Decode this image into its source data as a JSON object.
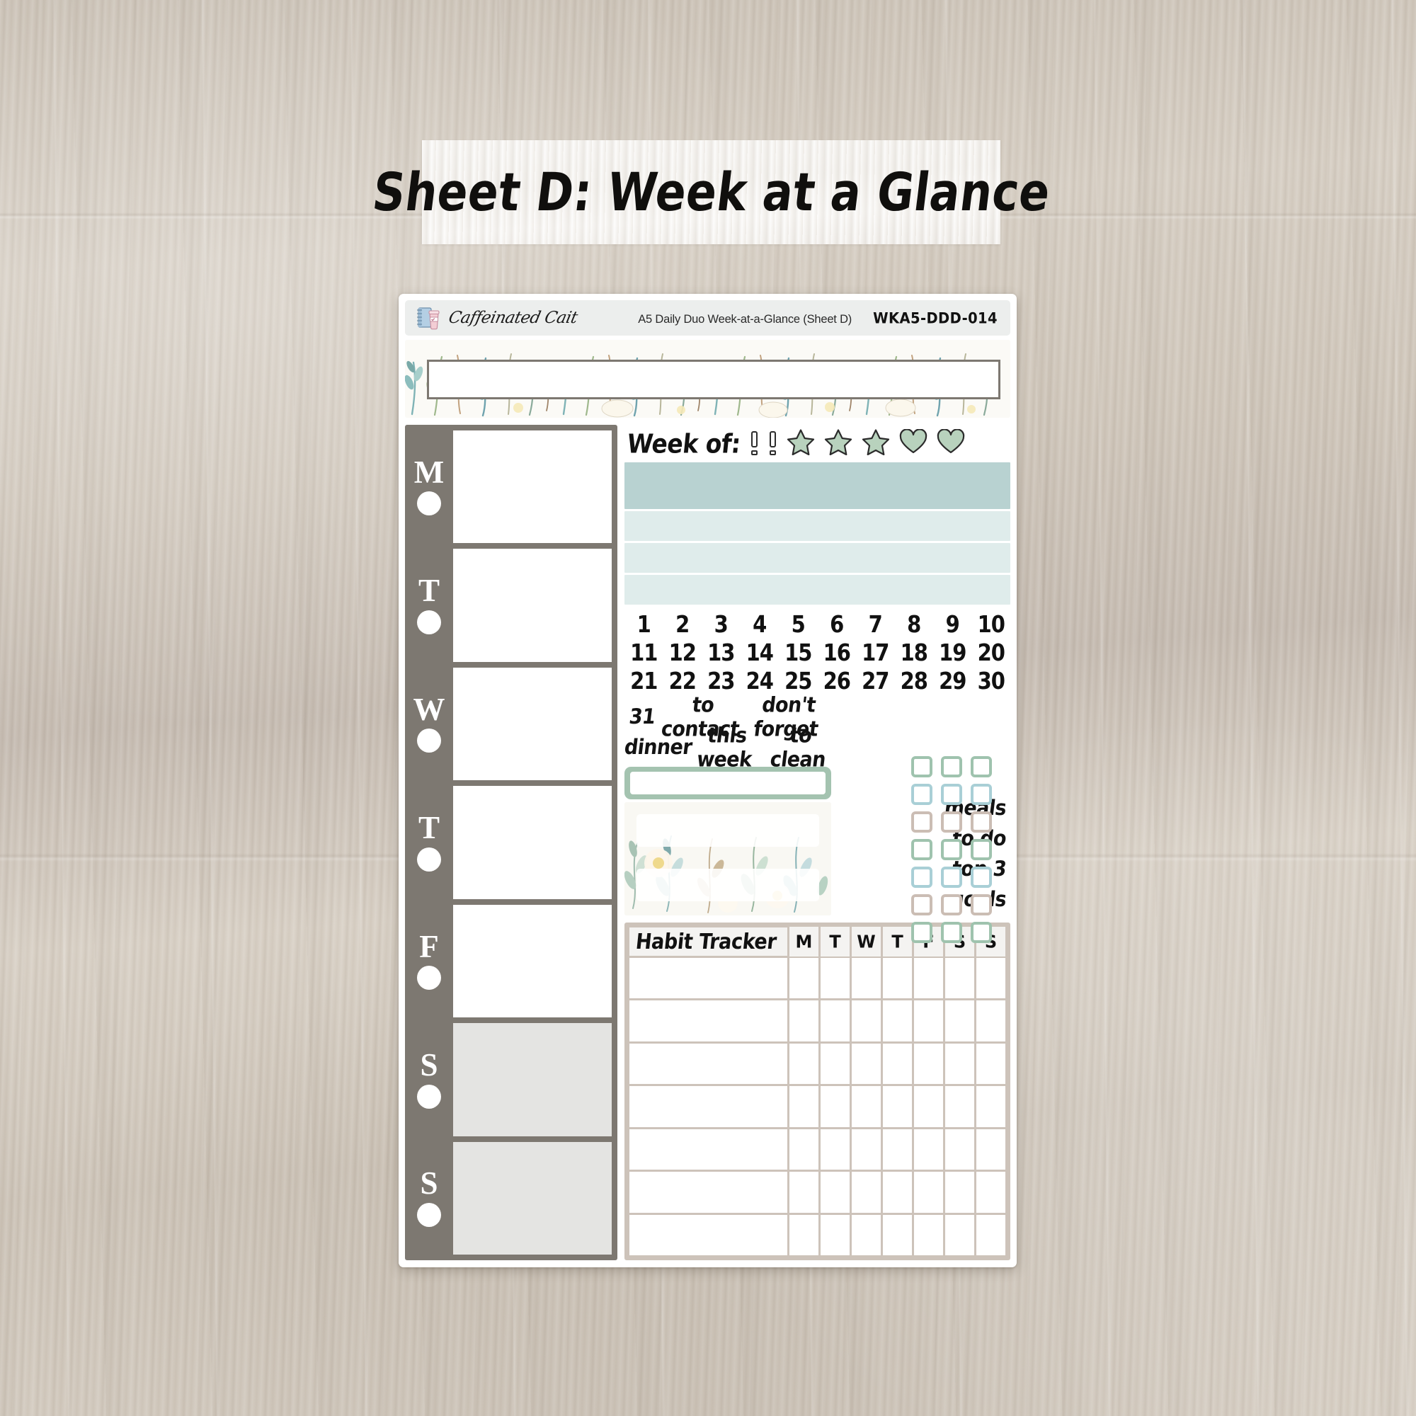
{
  "page": {
    "background": "wood-desk",
    "background_color": "#cfc6ba"
  },
  "title_banner": {
    "text": "Sheet D: Week at a Glance"
  },
  "sheet": {
    "header": {
      "brand_name": "Caffeinated Cait",
      "logo_icon": "notebook-coffee-cup-icon",
      "description": "A5 Daily Duo Week-at-a-Glance (Sheet D)",
      "product_code": "WKA5-DDD-014"
    },
    "floral_banner": {
      "header_box_label": ""
    },
    "day_column": {
      "days": [
        {
          "letter": "M",
          "weekend": false
        },
        {
          "letter": "T",
          "weekend": false
        },
        {
          "letter": "W",
          "weekend": false
        },
        {
          "letter": "T",
          "weekend": false
        },
        {
          "letter": "F",
          "weekend": false
        },
        {
          "letter": "S",
          "weekend": true
        },
        {
          "letter": "S",
          "weekend": true
        }
      ]
    },
    "week_of": {
      "label": "Week of:",
      "icons": [
        "exclamation-icon",
        "exclamation-icon",
        "star-icon",
        "star-icon",
        "star-icon",
        "heart-icon",
        "heart-icon"
      ]
    },
    "bands": [
      {
        "tone": "dark",
        "color": "#b8d2d1"
      },
      {
        "tone": "light",
        "color": "#dfeceb"
      },
      {
        "tone": "light",
        "color": "#dfeceb"
      },
      {
        "tone": "light",
        "color": "#dfeceb"
      }
    ],
    "date_numbers": [
      "1",
      "2",
      "3",
      "4",
      "5",
      "6",
      "7",
      "8",
      "9",
      "10",
      "11",
      "12",
      "13",
      "14",
      "15",
      "16",
      "17",
      "18",
      "19",
      "20",
      "21",
      "22",
      "23",
      "24",
      "25",
      "26",
      "27",
      "28",
      "29",
      "30"
    ],
    "word_rows": [
      [
        "31",
        "to contact",
        "don't forget"
      ],
      [
        "dinner",
        "this week",
        "to clean"
      ]
    ],
    "side_labels": [
      "meals",
      "to do",
      "top 3",
      "goals"
    ],
    "checkbox_grid": {
      "columns": 3,
      "rows": 7,
      "row_colors": [
        "#9fc3ae",
        "#a9cfd6",
        "#cbbdb4",
        "#9fc3ae",
        "#a9cfd6",
        "#cbbdb4",
        "#9fc3ae"
      ]
    },
    "sage_label": {
      "color": "#a4c3b0"
    },
    "floral_label_block": {
      "strips": 2
    },
    "habit_tracker": {
      "title": "Habit Tracker",
      "day_headers": [
        "M",
        "T",
        "W",
        "T",
        "F",
        "S",
        "S"
      ],
      "row_count": 7
    }
  },
  "colors": {
    "sheet_gray": "#7d7871",
    "weekend_gray": "#e4e4e2",
    "band_dark_teal": "#b8d2d1",
    "band_light_teal": "#dfeceb",
    "sage": "#a4c3b0",
    "blue_box": "#a9cfd6",
    "taupe_box": "#cbbdb4",
    "habit_frame": "#cdc3ba",
    "header_strip": "#eceeed"
  }
}
